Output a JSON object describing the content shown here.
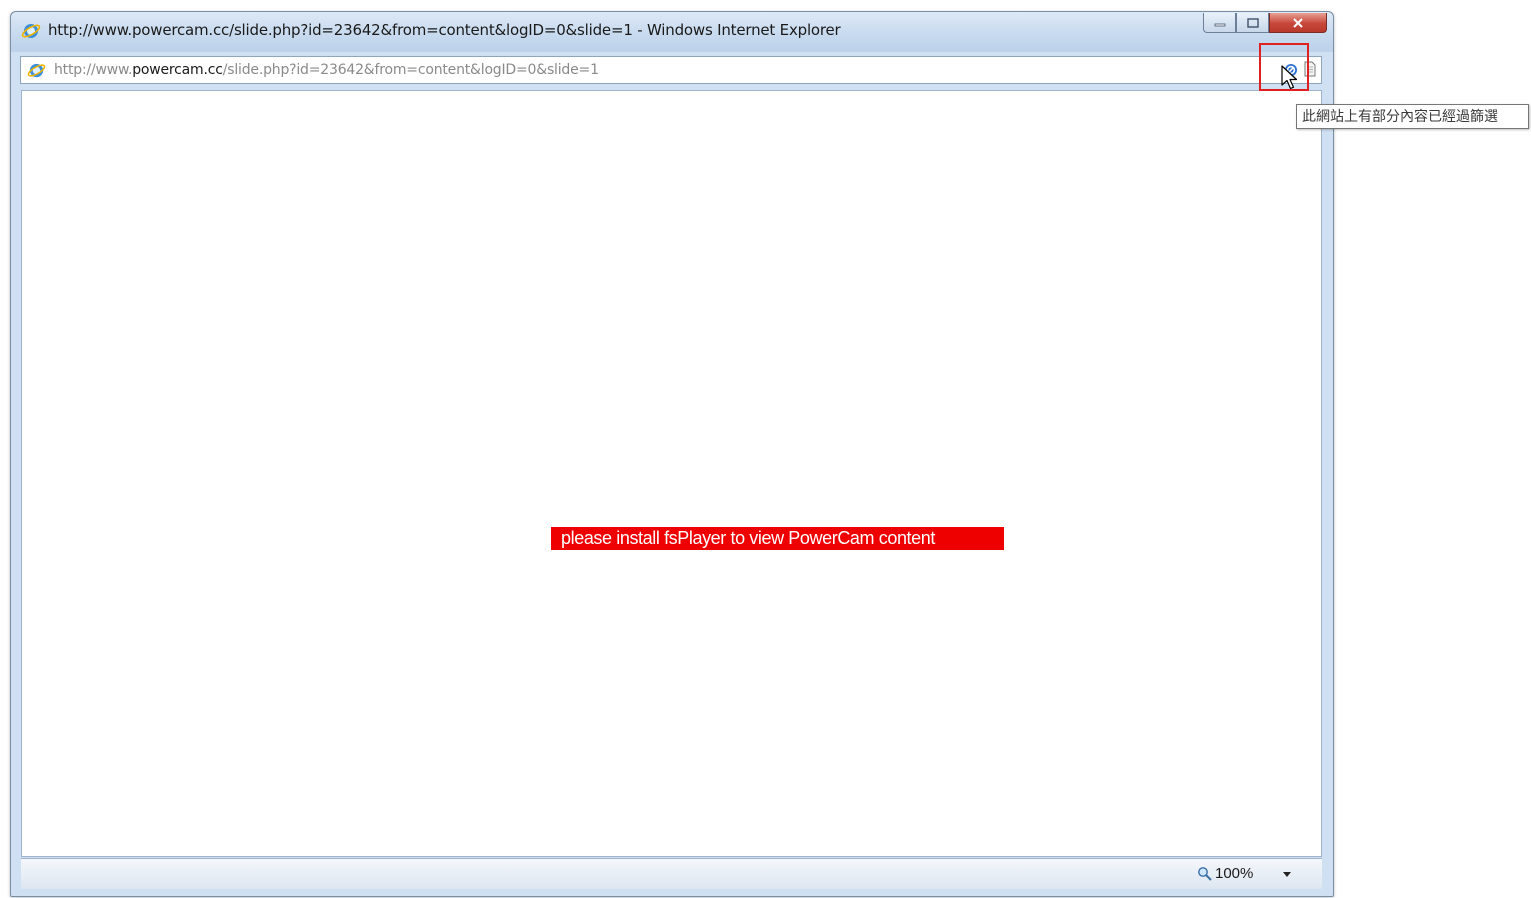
{
  "window": {
    "title": "http://www.powercam.cc/slide.php?id=23642&from=content&logID=0&slide=1 - Windows Internet Explorer",
    "browser_icon": "ie-icon"
  },
  "address_bar": {
    "prefix": "http://www.",
    "domain": "powercam.cc",
    "path": "/slide.php?id=23642&from=content&logID=0&slide=1",
    "blocked_content_icon": "blocked-content-icon",
    "page_icon": "page-icon"
  },
  "content": {
    "message": "please install fsPlayer to view PowerCam content"
  },
  "status_bar": {
    "zoom": "100%",
    "zoom_icon": "magnifier-icon"
  },
  "tooltip": {
    "text": "此網站上有部分內容已經過篩選"
  },
  "colors": {
    "message_bg": "#ee0000",
    "highlight": "#e02020",
    "frame": "#cfe0f2"
  }
}
